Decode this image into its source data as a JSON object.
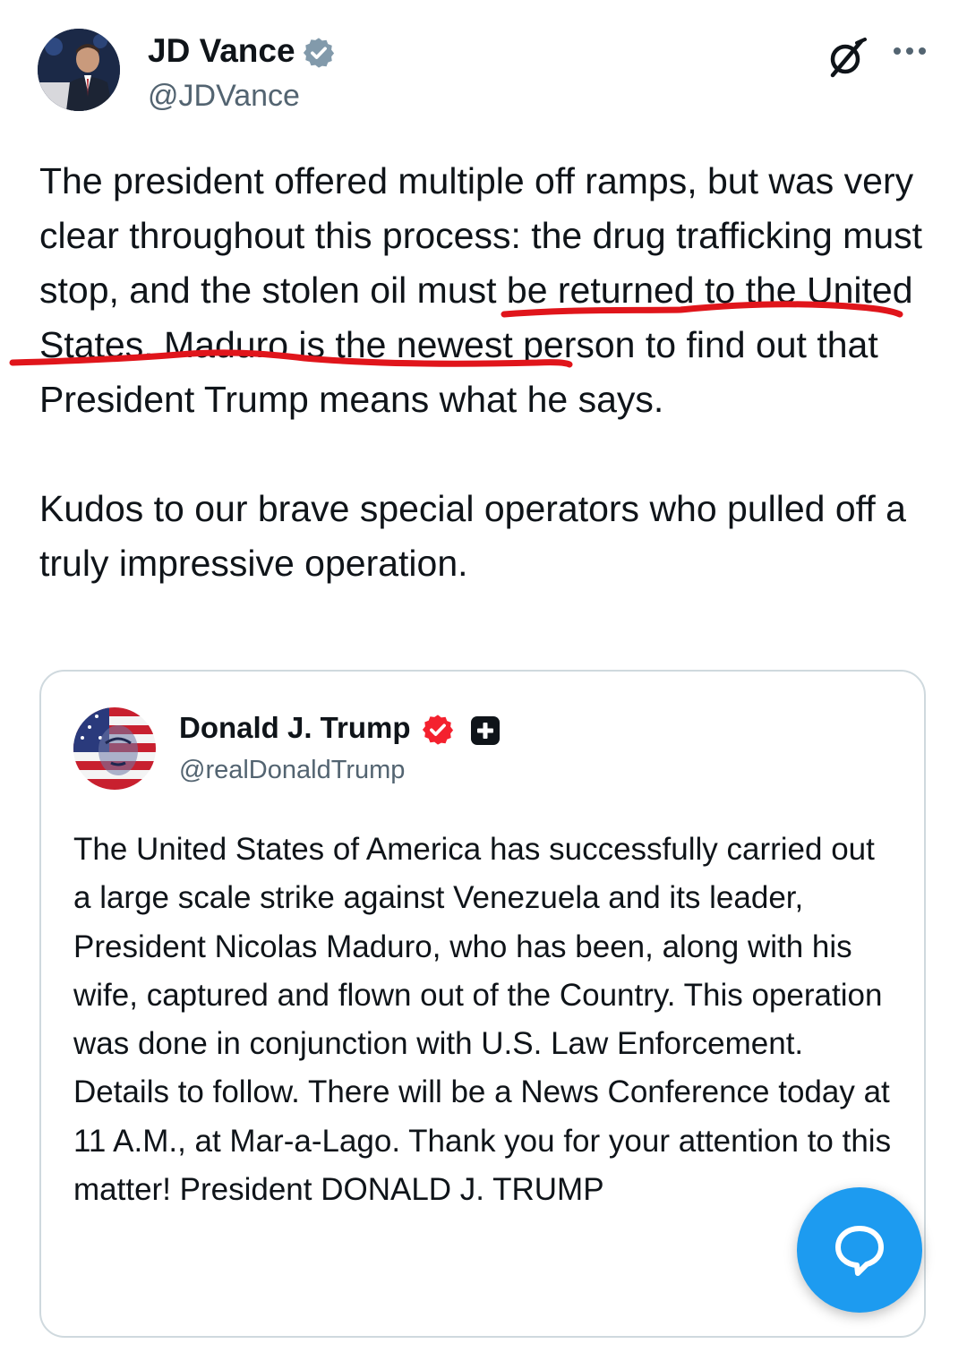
{
  "author": {
    "name": "JD Vance",
    "handle": "@JDVance",
    "verified": true,
    "badge_color": "#829aab"
  },
  "header_actions": {
    "grok_icon": "grok-icon",
    "more_icon": "more-icon"
  },
  "tweet": {
    "paragraph1": "The president offered multiple off ramps, but was very clear throughout this process: the drug trafficking must stop, and the stolen oil must be returned to the United States. Maduro is the newest person to find out that President Trump means what he says.",
    "paragraph2": "Kudos to our brave special operators who pulled off a truly impressive operation.",
    "highlight_color": "#e0151b"
  },
  "quoted_post": {
    "name": "Donald J. Trump",
    "handle": "@realDonaldTrump",
    "verified": true,
    "badge_color": "#f4212e",
    "text": "The United States of America has successfully carried out a large scale strike against Venezuela and its leader, President Nicolas Maduro, who has been, along with his wife, captured and flown out of the Country. This operation was done in conjunction with U.S. Law Enforcement. Details to follow. There will be a News Conference today at 11 A.M., at Mar-a-Lago. Thank you for your attention to this matter! President DONALD J. TRUMP"
  },
  "fab": {
    "icon": "compose-reply-icon",
    "color": "#1d9bf0"
  }
}
